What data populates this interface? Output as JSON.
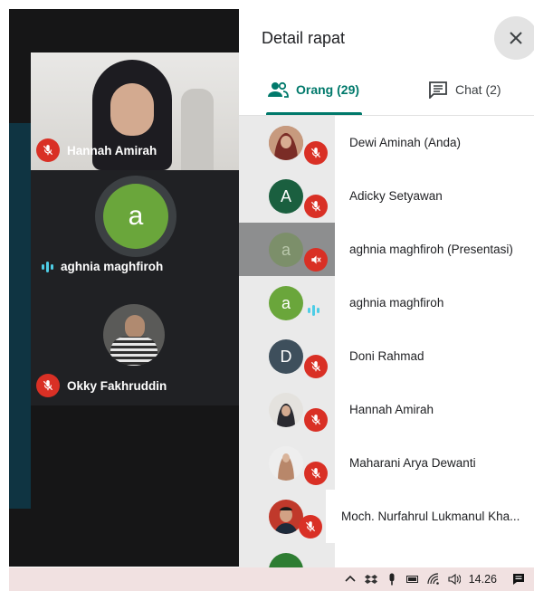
{
  "panel": {
    "title": "Detail rapat",
    "tabs": [
      {
        "label": "Orang (29)",
        "icon": "people-icon",
        "active": true
      },
      {
        "label": "Chat (2)",
        "icon": "chat-icon",
        "active": false
      }
    ]
  },
  "videos": {
    "tiles": [
      {
        "name": "Hannah Amirah",
        "muted": true
      },
      {
        "name": "aghnia maghfiroh",
        "avatar_letter": "a",
        "speaking": true
      },
      {
        "name": "Okky Fakhruddin",
        "muted": true
      }
    ]
  },
  "participants": [
    {
      "name": "Dewi Aminah (Anda)",
      "avatar": "photo",
      "muted": true
    },
    {
      "name": "Adicky Setyawan",
      "letter": "A",
      "color": "#1a5f3f",
      "muted": true
    },
    {
      "name": "aghnia maghfiroh (Presentasi)",
      "letter": "a",
      "color": "#6aa63b",
      "presenting": true,
      "highlighted": true
    },
    {
      "name": "aghnia maghfiroh",
      "letter": "a",
      "color": "#6aa63b",
      "speaking": true
    },
    {
      "name": "Doni Rahmad",
      "letter": "D",
      "color": "#3e4f5c",
      "muted": true
    },
    {
      "name": "Hannah Amirah",
      "avatar": "photo",
      "muted": true
    },
    {
      "name": "Maharani Arya Dewanti",
      "avatar": "photo",
      "muted": true
    },
    {
      "name": "Moch. Nurfahrul Lukmanul Kha...",
      "avatar": "photo",
      "muted": true
    }
  ],
  "taskbar": {
    "icons": [
      "chevron-up-icon",
      "dropbox-icon",
      "microphone-icon",
      "battery-icon",
      "wifi-icon",
      "volume-icon"
    ],
    "time": "14.26",
    "notification_icon": "action-center-icon"
  },
  "colors": {
    "accent": "#00796b",
    "mute_red": "#d93025",
    "speaking_cyan": "#4ecde6"
  }
}
